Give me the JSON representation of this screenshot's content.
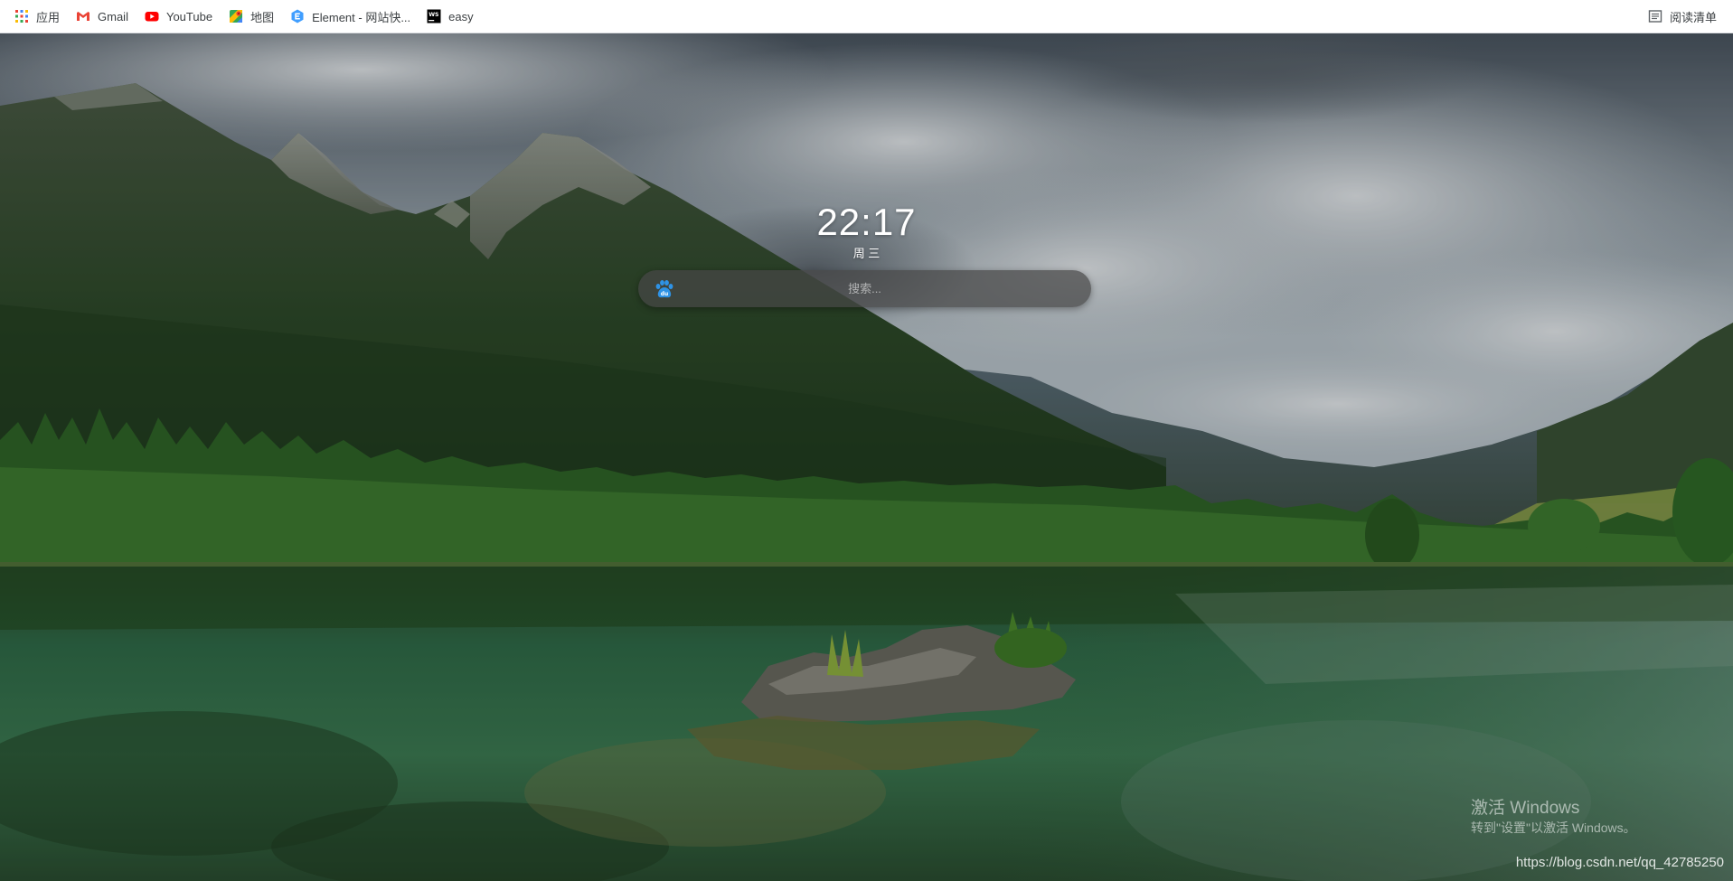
{
  "bookmarks": [
    {
      "label": "应用",
      "icon": "apps-grid-icon"
    },
    {
      "label": "Gmail",
      "icon": "gmail-icon"
    },
    {
      "label": "YouTube",
      "icon": "youtube-icon"
    },
    {
      "label": "地图",
      "icon": "maps-icon"
    },
    {
      "label": "Element - 网站快...",
      "icon": "element-icon"
    },
    {
      "label": "easy",
      "icon": "webstorm-icon"
    }
  ],
  "reading_list": {
    "label": "阅读清单",
    "icon": "reading-list-icon"
  },
  "clock": {
    "time": "22:17",
    "weekday": "周 三"
  },
  "search": {
    "placeholder": "搜索...",
    "value": "",
    "engine_icon": "baidu-paw-icon"
  },
  "watermark": {
    "title": "激活 Windows",
    "subtitle": "转到\"设置\"以激活 Windows。"
  },
  "footer": {
    "url": "https://blog.csdn.net/qq_42785250"
  },
  "colors": {
    "accent_blue": "#1a73e8",
    "youtube_red": "#ff0000",
    "gmail_red": "#ea4335",
    "baidu_blue": "#2932e1"
  }
}
